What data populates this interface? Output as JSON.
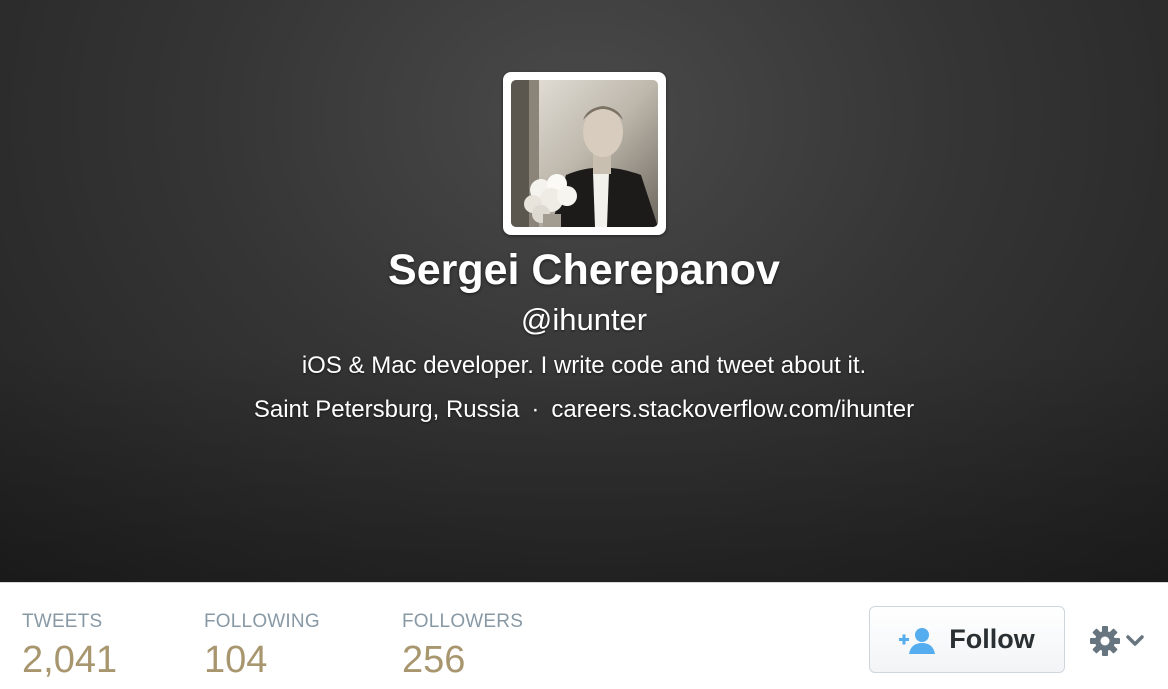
{
  "profile": {
    "name": "Sergei Cherepanov",
    "handle": "@ihunter",
    "bio": "iOS & Mac developer. I write code and tweet about it.",
    "location": "Saint Petersburg, Russia",
    "separator": "·",
    "url": "careers.stackoverflow.com/ihunter"
  },
  "stats": [
    {
      "label": "TWEETS",
      "value": "2,041"
    },
    {
      "label": "FOLLOWING",
      "value": "104"
    },
    {
      "label": "FOLLOWERS",
      "value": "256"
    }
  ],
  "actions": {
    "follow_label": "Follow",
    "follow_icon": "add-user-icon",
    "settings_icon": "gear-icon",
    "dropdown_icon": "chevron-down-icon"
  },
  "colors": {
    "stat_label": "#8899a6",
    "stat_value": "#a8966f",
    "follow_icon": "#55acee",
    "gear": "#66757f"
  }
}
